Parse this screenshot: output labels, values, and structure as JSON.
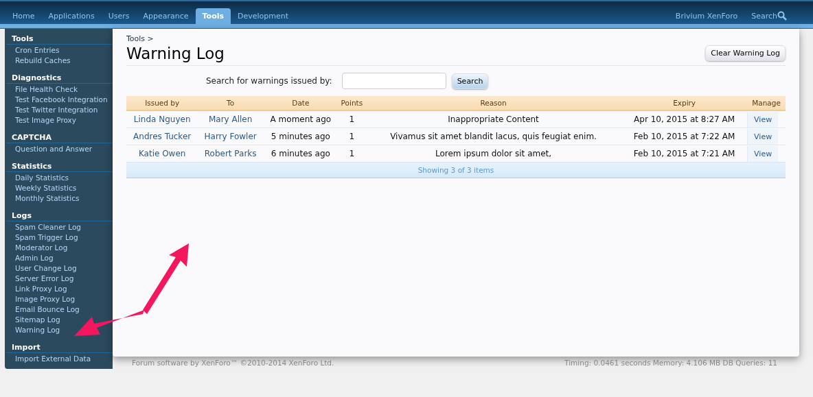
{
  "top_nav": {
    "tabs": [
      {
        "label": "Home",
        "selected": false
      },
      {
        "label": "Applications",
        "selected": false
      },
      {
        "label": "Users",
        "selected": false
      },
      {
        "label": "Appearance",
        "selected": false
      },
      {
        "label": "Tools",
        "selected": true
      },
      {
        "label": "Development",
        "selected": false
      }
    ],
    "right_links": [
      "Brivium XenForo"
    ],
    "search_label": "Search"
  },
  "sidebar": {
    "sections": [
      {
        "title": "Tools",
        "items": [
          "Cron Entries",
          "Rebuild Caches"
        ]
      },
      {
        "title": "Diagnostics",
        "items": [
          "File Health Check",
          "Test Facebook Integration",
          "Test Twitter Integration",
          "Test Image Proxy"
        ]
      },
      {
        "title": "CAPTCHA",
        "items": [
          "Question and Answer"
        ]
      },
      {
        "title": "Statistics",
        "items": [
          "Daily Statistics",
          "Weekly Statistics",
          "Monthly Statistics"
        ]
      },
      {
        "title": "Logs",
        "items": [
          "Spam Cleaner Log",
          "Spam Trigger Log",
          "Moderator Log",
          "Admin Log",
          "User Change Log",
          "Server Error Log",
          "Link Proxy Log",
          "Image Proxy Log",
          "Email Bounce Log",
          "Sitemap Log",
          "Warning Log"
        ]
      },
      {
        "title": "Import",
        "items": [
          "Import External Data"
        ]
      }
    ]
  },
  "breadcrumb": "Tools >",
  "title": "Warning Log",
  "clear_button": "Clear Warning Log",
  "search": {
    "label": "Search for warnings issued by:",
    "button": "Search"
  },
  "table": {
    "columns": [
      "Issued by",
      "To",
      "Date",
      "Points",
      "Reason",
      "Expiry",
      "Manage"
    ],
    "rows": [
      {
        "issued_by": "Linda Nguyen",
        "to": "Mary Allen",
        "date": "A moment ago",
        "points": "1",
        "reason": "Inappropriate Content",
        "expiry": "Apr 10, 2015 at 8:27 AM",
        "action": "View"
      },
      {
        "issued_by": "Andres Tucker",
        "to": "Harry Fowler",
        "date": "5 minutes ago",
        "points": "1",
        "reason": "Vivamus sit amet blandit lacus, quis feugiat enim.",
        "expiry": "Feb 10, 2015 at 7:22 AM",
        "action": "View"
      },
      {
        "issued_by": "Katie Owen",
        "to": "Robert Parks",
        "date": "6 minutes ago",
        "points": "1",
        "reason": "Lorem ipsum dolor sit amet,",
        "expiry": "Feb 10, 2015 at 7:21 AM",
        "action": "View"
      }
    ],
    "footer": "Showing 3 of 3 items"
  },
  "footer": {
    "copyright": "Forum software by XenForo™ ©2010-2014 XenForo Ltd.",
    "stats": "Timing: 0.0461 seconds Memory: 4.106 MB DB Queries: 11"
  }
}
